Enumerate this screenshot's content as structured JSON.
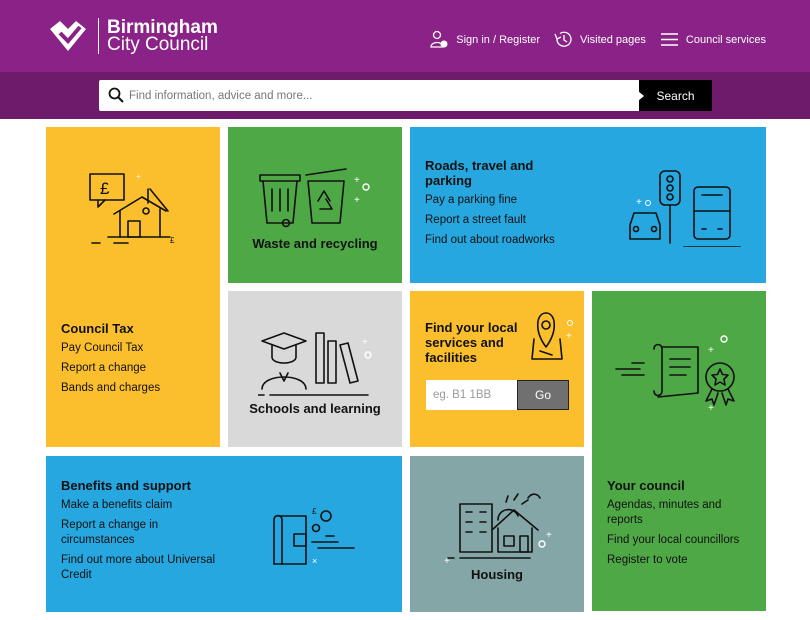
{
  "header": {
    "logo_line1": "Birmingham",
    "logo_line2": "City Council",
    "nav": {
      "sign_in": "Sign in / Register",
      "visited": "Visited pages",
      "services": "Council services"
    }
  },
  "search": {
    "placeholder": "Find information, advice and more...",
    "button": "Search"
  },
  "tiles": {
    "council_tax": {
      "title": "Council Tax",
      "links": [
        "Pay Council Tax",
        "Report a change",
        "Bands and charges"
      ]
    },
    "waste": {
      "title": "Waste and recycling"
    },
    "roads": {
      "title_line1": "Roads, travel and",
      "title_line2": "parking",
      "links": [
        "Pay a parking fine",
        "Report a street fault",
        "Find out about roadworks"
      ]
    },
    "schools": {
      "title": "Schools and learning"
    },
    "local_services": {
      "title_line1": "Find your local",
      "title_line2": "services and",
      "title_line3": "facilities",
      "placeholder": "eg. B1 1BB",
      "button": "Go"
    },
    "your_council": {
      "title": "Your council",
      "links": [
        "Agendas, minutes and reports",
        "Find your local councillors",
        "Register to vote"
      ]
    },
    "benefits": {
      "title": "Benefits and support",
      "links": [
        "Make a benefits claim",
        "Report a change in circumstances",
        "Find out more about Universal Credit"
      ]
    },
    "housing": {
      "title": "Housing"
    }
  },
  "icons": {
    "logo": "heart-logo-icon",
    "sign_in": "user-lock-icon",
    "visited": "history-icon",
    "services": "menu-icon",
    "search": "search-icon"
  },
  "colors": {
    "header": "#8a2287",
    "search_band": "#6e1b6c",
    "yellow": "#fbbf2e",
    "green": "#4fa846",
    "blue": "#26a7e0",
    "grey": "#d9d9d9",
    "slate": "#84a6a6"
  }
}
